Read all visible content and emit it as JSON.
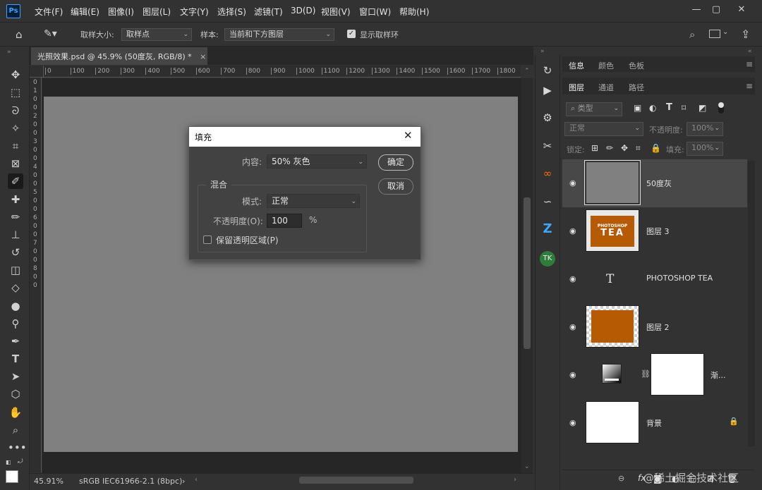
{
  "app": {
    "logo": "Ps",
    "menu": [
      "文件(F)",
      "编辑(E)",
      "图像(I)",
      "图层(L)",
      "文字(Y)",
      "选择(S)",
      "滤镜(T)",
      "3D(D)",
      "视图(V)",
      "窗口(W)",
      "帮助(H)"
    ],
    "window_controls": [
      "—",
      "▢",
      "✕"
    ]
  },
  "options_bar": {
    "sample_size_label": "取样大小:",
    "sample_size_value": "取样点",
    "sample_label": "样本:",
    "sample_value": "当前和下方图层",
    "show_ring_label": "显示取样环",
    "show_ring_checked": true
  },
  "document": {
    "tab_title": "光照效果.psd @ 45.9% (50度灰, RGB/8) *",
    "tab_close": "×",
    "ruler_h": [
      "0",
      "100",
      "200",
      "300",
      "400",
      "500",
      "600",
      "700",
      "800",
      "900",
      "1000",
      "1100",
      "1200",
      "1300",
      "1400",
      "1500",
      "1600",
      "1700",
      "1800"
    ],
    "ruler_v": [
      "0",
      "1",
      "0",
      "0",
      "2",
      "0",
      "0",
      "3",
      "0",
      "0",
      "4",
      "0",
      "0",
      "5",
      "0",
      "0",
      "6",
      "0",
      "0",
      "7",
      "0",
      "0",
      "8",
      "0",
      "0"
    ],
    "canvas_color": "#808080"
  },
  "status_bar": {
    "zoom": "45.91%",
    "profile": "sRGB IEC61966-2.1 (8bpc)",
    "arrow": "›"
  },
  "dialog": {
    "title": "填充",
    "content_label": "内容:",
    "content_value": "50% 灰色",
    "ok_label": "确定",
    "cancel_label": "取消",
    "blend_group": "混合",
    "mode_label": "模式:",
    "mode_value": "正常",
    "opacity_label": "不透明度(O):",
    "opacity_value": "100",
    "opacity_unit": "%",
    "preserve_label": "保留透明区域(P)"
  },
  "panels": {
    "top_tabs": [
      "信息",
      "颜色",
      "色板"
    ],
    "layer_tabs": [
      "图层",
      "通道",
      "路径"
    ],
    "filter_placeholder": "类型",
    "blend_mode": "正常",
    "opacity_label": "不透明度:",
    "opacity_value": "100%",
    "lock_label": "锁定:",
    "fill_label": "填充:",
    "fill_value": "100%",
    "layers": [
      {
        "name": "50度灰",
        "type": "fill",
        "selected": true
      },
      {
        "name": "图层 3",
        "type": "image",
        "thumb_text": [
          "PHOTOSHOP",
          "TEA"
        ]
      },
      {
        "name": "PHOTOSHOP TEA",
        "type": "text",
        "glyph": "T"
      },
      {
        "name": "图层 2",
        "type": "image"
      },
      {
        "name": "渐...",
        "type": "adjustment"
      },
      {
        "name": "背景",
        "type": "background",
        "locked": true
      }
    ],
    "footer_icons": [
      "⊖",
      "fx",
      "◐",
      "▢",
      "▣",
      "⊞",
      "🗑"
    ]
  },
  "watermark": "@稀土掘金技术社区",
  "colors": {
    "accent": "#31a8ff",
    "tea_orange": "#b65a04",
    "canvas_gray": "#808080"
  }
}
